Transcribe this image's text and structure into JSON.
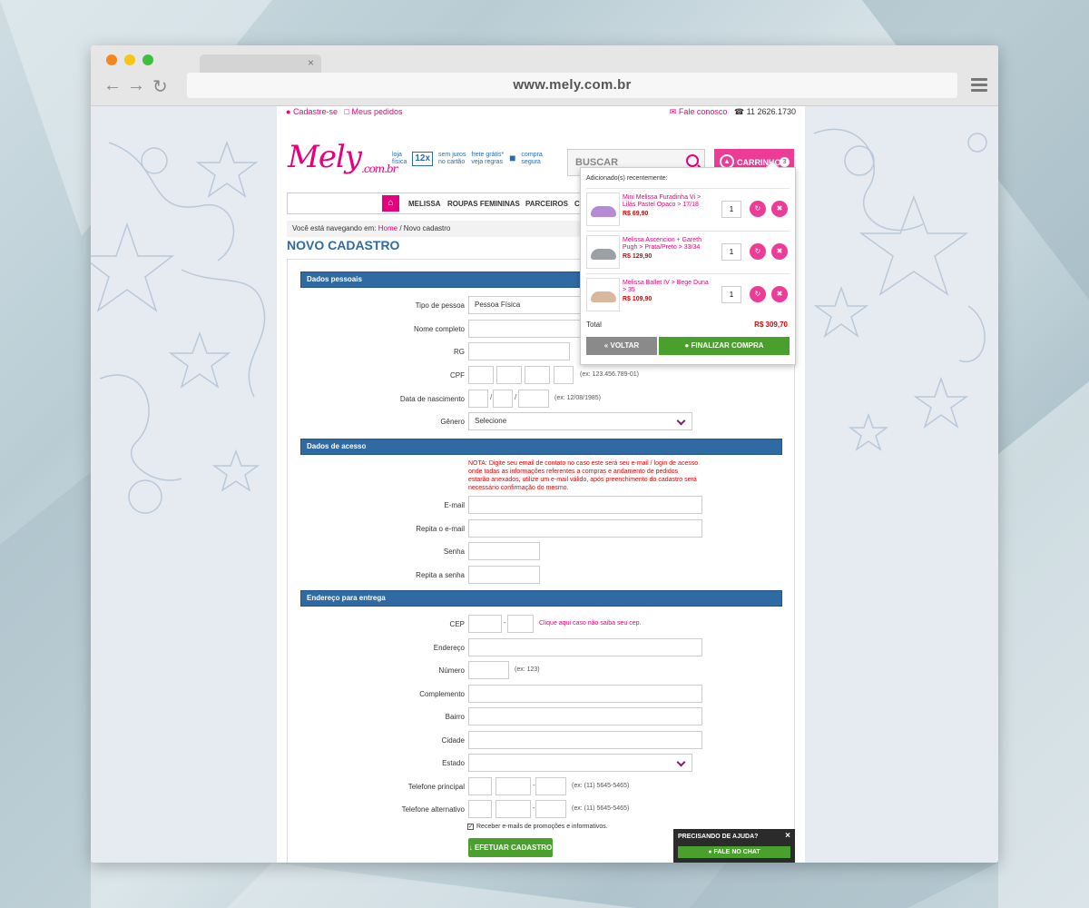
{
  "browser": {
    "url": "www.mely.com.br",
    "tab_close": "×",
    "nav": {
      "back": "←",
      "forward": "→",
      "reload": "↻"
    }
  },
  "topbar": {
    "signup": "Cadastre-se",
    "orders": "Meus pedidos",
    "contact": "Fale conosco",
    "phone": "11 2626.1730"
  },
  "header": {
    "logo_main": "Mely",
    "logo_suffix": ".com.br",
    "badges": {
      "loja_1": "loja",
      "loja_2": "física",
      "parcelas": "12x",
      "juros_1": "sem juros",
      "juros_2": "no cartão",
      "frete_1": "frete grátis*",
      "frete_2": "veja regras",
      "segura_1": "compra",
      "segura_2": "segura"
    },
    "search_placeholder": "BUSCAR",
    "cart_label": "CARRINHO",
    "cart_count": "3"
  },
  "mainnav": {
    "items": [
      "MELISSA",
      "ROUPAS FEMININAS",
      "PARCEIROS",
      "C"
    ]
  },
  "breadcrumb": {
    "prefix": "Você está navegando em:",
    "home": "Home",
    "current": "/ Novo cadastro"
  },
  "page_title": "NOVO CADASTRO",
  "form": {
    "section_personal": "Dados pessoais",
    "tipo_label": "Tipo de pessoa",
    "tipo_value": "Pessoa Física",
    "nome_label": "Nome completo",
    "rg_label": "RG",
    "cpf_label": "CPF",
    "cpf_hint": "(ex: 123.456.789-01)",
    "nasc_label": "Data de nascimento",
    "nasc_hint": "(ex: 12/08/1985)",
    "genero_label": "Gênero",
    "genero_value": "Selecione",
    "section_access": "Dados de acesso",
    "note": "NOTA: Digite seu email de contato no caso este será seu e-mail / login de acesso onde todas as informações referentes a compras e andamento de pedidos estarão anexados, utilize um e-mail válido, após preenchimento do cadastro será necessário confirmação do mesmo.",
    "email_label": "E-mail",
    "email2_label": "Repita o e-mail",
    "senha_label": "Senha",
    "senha2_label": "Repita a senha",
    "section_address": "Endereço para entrega",
    "cep_label": "CEP",
    "cep_link": "Clique aqui caso não saiba seu cep.",
    "endereco_label": "Endereço",
    "numero_label": "Número",
    "numero_hint": "(ex: 123)",
    "complemento_label": "Complemento",
    "bairro_label": "Bairro",
    "cidade_label": "Cidade",
    "estado_label": "Estado",
    "tel1_label": "Telefone principal",
    "tel1_hint": "(ex: (11) 5645-5465)",
    "tel2_label": "Telefone alternativo",
    "tel2_hint": "(ex: (11) 5645-5465)",
    "newsletter": "Receber e-mails de promoções e informativos.",
    "submit": "EFETUAR CADASTRO"
  },
  "cart_dropdown": {
    "heading": "Adicionado(s) recentemente:",
    "items": [
      {
        "name": "Mini Melissa Furadinha Vi > Lilás Pastel Opaco > 17/18",
        "price": "R$ 69,90",
        "qty": "1",
        "shoe_color": "#b58ad6"
      },
      {
        "name": "Melissa Ascencion + Gareth Pugh > Prata/Preto > 33/34",
        "price": "R$ 129,90",
        "qty": "1",
        "shoe_color": "#9aa0a6"
      },
      {
        "name": "Melissa Ballet IV > Bege Duna > 35",
        "price": "R$ 109,90",
        "qty": "1",
        "shoe_color": "#d9b8a0"
      }
    ],
    "total_label": "Total",
    "total_value": "R$ 309,70",
    "back": "VOLTAR",
    "finish": "FINALIZAR COMPRA"
  },
  "help": {
    "title": "PRECISANDO DE AJUDA?",
    "close": "×",
    "chat": "FALE NO CHAT"
  },
  "colors": {
    "brand_pink": "#e6007e",
    "section_blue": "#2f6aa3",
    "action_green": "#4aa02c"
  }
}
